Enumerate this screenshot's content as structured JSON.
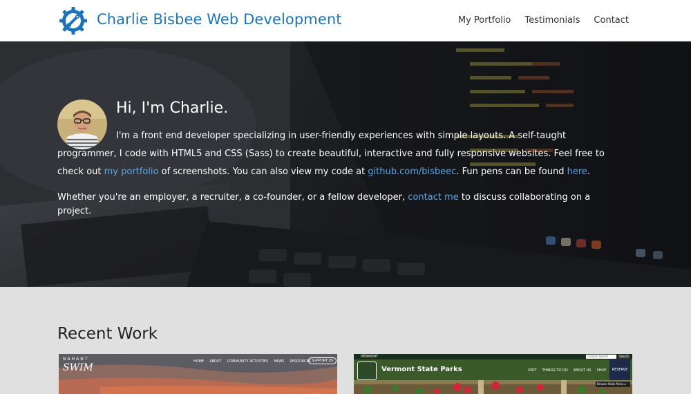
{
  "header": {
    "brand": "Charlie Bisbee Web Development",
    "nav": [
      "My Portfolio",
      "Testimonials",
      "Contact"
    ],
    "colors": {
      "brand": "#1e73b8"
    }
  },
  "hero": {
    "greeting": "Hi, I'm Charlie.",
    "intro_1": "I'm a front end developer specializing in user-friendly experiences with simple layouts. A self-taught programmer, I code with HTML5 and CSS (Sass) to create beautiful, interactive and fully responsive websites. Feel free to check out ",
    "portfolio_link": "my portfolio",
    "intro_2": " of screenshots. You can also view my code at ",
    "github_link": "github.com/bisbeec",
    "intro_3": ". Fun pens can be found ",
    "pens_link": "here",
    "intro_4": ".",
    "collab_1": "Whether you're an employer, a recruiter, a co-founder, or a fellow developer, ",
    "contact_link": "contact me",
    "collab_2": " to discuss collaborating on a project.",
    "colors": {
      "link": "#5aa7ea"
    }
  },
  "recent": {
    "title": "Recent Work",
    "cards": [
      {
        "site_name": "NAHANT",
        "logo_text": "SWIM",
        "nav": [
          "HOME",
          "ABOUT",
          "COMMUNITY ACTIVITIES",
          "NEWS",
          "RESOURCES"
        ],
        "button": "SUPPORT US"
      },
      {
        "top_label": "VERMONT",
        "search_placeholder": "Custom Search",
        "search_button": "Search",
        "title": "Vermont State Parks",
        "nav": [
          "VISIT",
          "THINGS TO DO",
          "ABOUT US",
          "SHOP"
        ],
        "reserve": "RESERVE",
        "dropdown": "Browse State Parks"
      }
    ]
  }
}
